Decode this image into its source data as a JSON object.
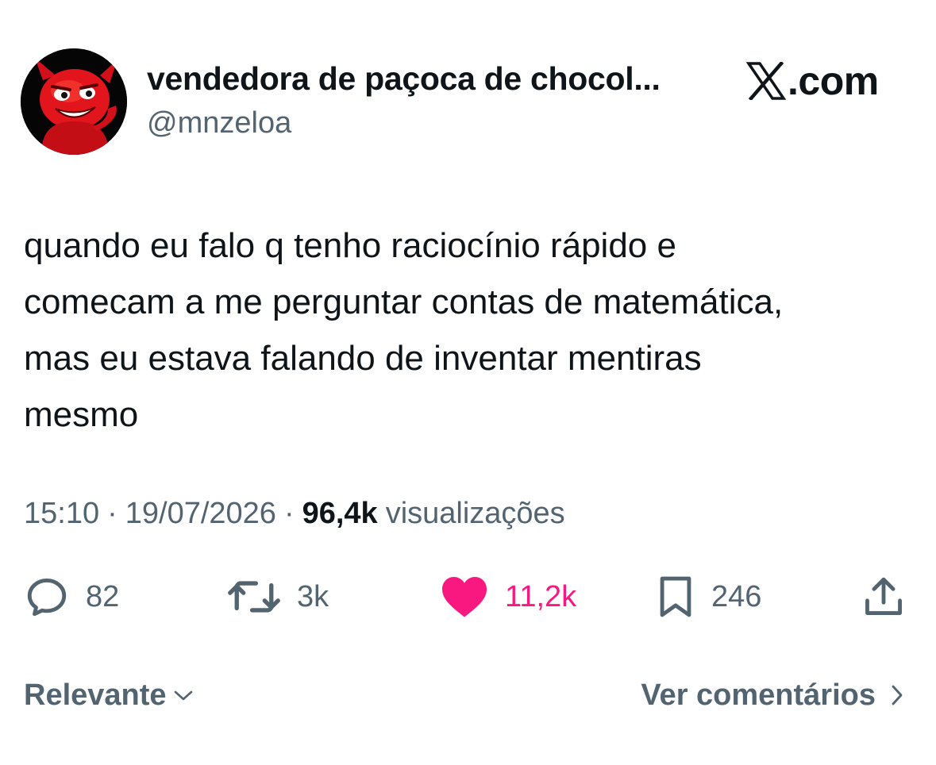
{
  "author": {
    "display_name": "vendedora de paçoca de chocol...",
    "handle": "@mnzeloa",
    "avatar_icon": "red-devil-avatar"
  },
  "brand": {
    "label": ".com",
    "icon": "x-logo-icon"
  },
  "tweet": {
    "lines": [
      "quando eu falo q tenho raciocínio rápido e",
      "comecam a me perguntar contas de matemática,",
      "mas eu estava falando de inventar mentiras",
      "mesmo"
    ]
  },
  "meta": {
    "time": "15:10",
    "separator": "·",
    "date": "19/07/2026",
    "views_count": "96,4k",
    "views_label": "visualizações"
  },
  "actions": {
    "replies": {
      "count": "82",
      "icon": "reply-icon"
    },
    "reposts": {
      "count": "3k",
      "icon": "repost-icon"
    },
    "likes": {
      "count": "11,2k",
      "icon": "heart-icon",
      "color": "#f91880"
    },
    "bookmarks": {
      "count": "246",
      "icon": "bookmark-icon"
    },
    "share": {
      "icon": "share-icon"
    }
  },
  "footer": {
    "sort_label": "Relevante",
    "comments_label": "Ver comentários"
  },
  "colors": {
    "text_primary": "#0f1419",
    "text_secondary": "#536471",
    "like_pink": "#f91880"
  }
}
